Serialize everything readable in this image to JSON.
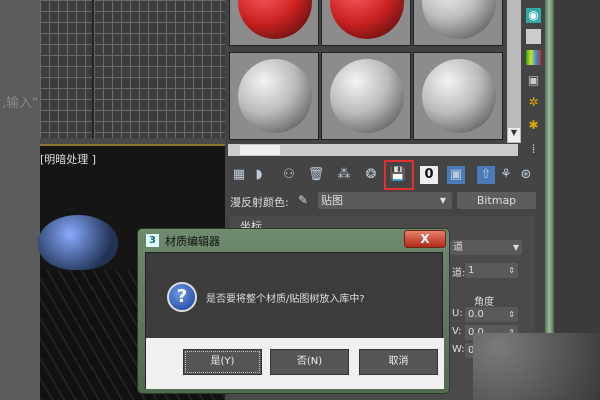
{
  "left_hint": ",输入\"",
  "viewport": {
    "label": "[明暗处理 ]"
  },
  "toolbar": {
    "icons": [
      "get-material-icon",
      "put-to-scene-icon",
      "assign-to-selection-icon",
      "reset-map-icon",
      "make-unique-icon",
      "put-to-library-icon",
      "material-id-channel-icon",
      "show-shaded-map-icon",
      "show-end-result-icon",
      "go-to-parent-icon",
      "go-forward-sibling-icon"
    ],
    "material_id": "0"
  },
  "diffuse": {
    "label": "漫反射颜色:",
    "map_name": "贴图",
    "map_type": "Bitmap"
  },
  "rollout": {
    "title": "坐标",
    "channel_value": "道",
    "map_channel_label": "道:",
    "map_channel_value": "1",
    "angle_label": "角度",
    "u_label": "U:",
    "u_value": "0.0",
    "v_label": "V:",
    "v_value": "0.0",
    "w_label": "W:",
    "w_value": "0.0"
  },
  "dialog": {
    "app_badge": "3",
    "title": "材质编辑器",
    "close": "X",
    "icon": "?",
    "message": "是否要将整个材质/贴图树放入库中?",
    "yes": "是(Y)",
    "no": "否(N)",
    "cancel": "取消"
  }
}
